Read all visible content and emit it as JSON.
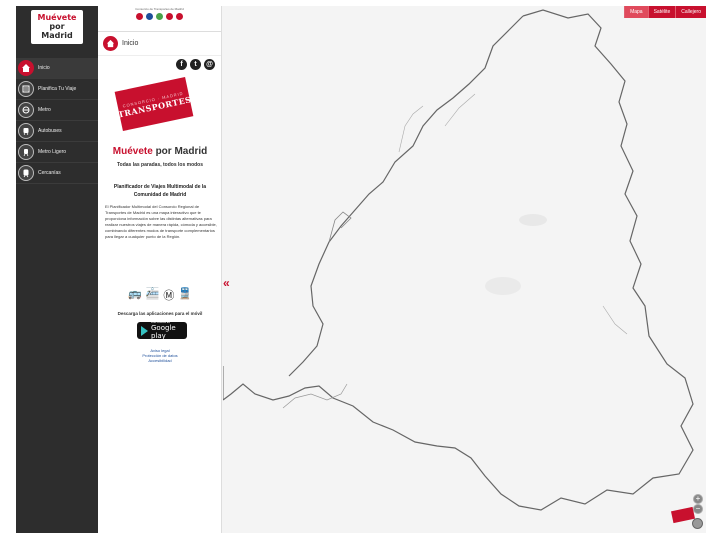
{
  "sidebar": {
    "logo": {
      "line1": "Muévete",
      "line2": "por",
      "line3": "Madrid"
    },
    "items": [
      {
        "label": "Inicio",
        "icon": "home-icon",
        "active": true
      },
      {
        "label": "Planifica Tu Viaje",
        "icon": "route-icon",
        "active": false
      },
      {
        "label": "Metro",
        "icon": "metro-icon",
        "active": false
      },
      {
        "label": "Autobuses",
        "icon": "bus-icon",
        "active": false
      },
      {
        "label": "Metro Ligero",
        "icon": "light-rail-icon",
        "active": false
      },
      {
        "label": "Cercanías",
        "icon": "train-icon",
        "active": false
      }
    ]
  },
  "panel": {
    "header_title": "Inicio",
    "topbar_text": "Consorcio de Transportes de Madrid",
    "stamp_text": "TRANSPORTES",
    "stamp_sub": "CONSORCIO · MADRID",
    "brand_red": "Muévete",
    "brand_dark": "por Madrid",
    "tagline": "Todas las paradas, todos los modos",
    "plan_title": "Planificador de Viajes Multimodal de la Comunidad de Madrid",
    "plan_body": "El Planificador Multimodal del Consorcio Regional de Transportes de Madrid es una mapa interactivo que te proporciona información sobre las distintas alternativas para realizar nuestros viajes de manera rápida, cómoda y accesible, combinando diferentes modos de transporte complementarios para llegar a cualquier punto de la Región.",
    "download_text": "Descarga las aplicaciones para el móvil",
    "gplay_small": "DISPONIBLE EN",
    "gplay_big": "Google play",
    "links": [
      "Aviso legal",
      "Protección de datos",
      "Accesibilidad"
    ]
  },
  "map": {
    "layers": [
      {
        "label": "Mapa",
        "selected": true
      },
      {
        "label": "Satélite",
        "selected": false
      },
      {
        "label": "Callejero",
        "selected": false
      }
    ],
    "zoom_in": "+",
    "zoom_out": "−"
  },
  "colors": {
    "accent": "#c8102e",
    "sidebar": "#2d2d2d"
  }
}
